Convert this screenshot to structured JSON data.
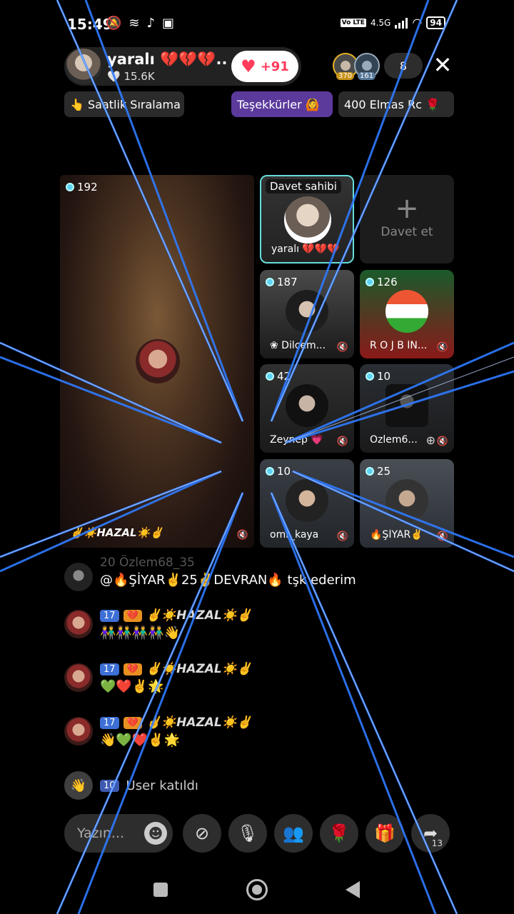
{
  "status_bar": {
    "time": "15:49",
    "network": "4.5G",
    "lte": "Vo LTE",
    "battery": "94"
  },
  "host": {
    "name": "yaralı 💔💔💔...",
    "likes": "🤍 15.6K",
    "follow_label": "+91"
  },
  "viewers": {
    "top1_rank": "370",
    "top2_rank": "161",
    "count": "8"
  },
  "chips": {
    "ranking": "👆 Saatlik Sıralama",
    "thanks": "Teşekkürler 🙆",
    "diamonds": "400 Elmas Rc 🌹"
  },
  "main_seat": {
    "gems": "192",
    "name": "✌️☀️HAZAL☀️✌️"
  },
  "host_seat": {
    "badge": "Davet sahibi",
    "name": "yaralı 💔💔💔😭"
  },
  "invite_seat": {
    "plus": "+",
    "label": "Davet et"
  },
  "seats": [
    {
      "gems": "187",
      "name": "❀ Dilcem..."
    },
    {
      "gems": "126",
      "name": "R O J B İN..."
    },
    {
      "gems": "42",
      "name": "Zeynep 💗"
    },
    {
      "gems": "10",
      "name": "Özlem6..."
    },
    {
      "gems": "10",
      "name": "omr_kaya"
    },
    {
      "gems": "25",
      "name": "🔥ŞİYAR✌️"
    }
  ],
  "chat": {
    "faded_line": "20 Özlem68_35",
    "messages": [
      {
        "text": "@🔥ŞİYAR✌️25✌️DEVRAN🔥 tşk ederim"
      },
      {
        "level": "17",
        "user": "✌️☀️HAZAL☀️✌️",
        "text": "👫👫👫👫👋"
      },
      {
        "level": "17",
        "user": "✌️☀️HAZAL☀️✌️",
        "text": "💚❤️✌️🌟"
      },
      {
        "level": "17",
        "user": "✌️☀️HAZAL☀️✌️",
        "text": "👋💚❤️✌️🌟"
      }
    ],
    "join": {
      "level": "10",
      "text": "User katıldı"
    }
  },
  "bottom_bar": {
    "input_placeholder": "Yazın...",
    "share_count": "13"
  },
  "colors": {
    "laser": "#2f7bff",
    "accent_purple": "#5b3a9c",
    "follow_red": "#ff3b5c"
  }
}
